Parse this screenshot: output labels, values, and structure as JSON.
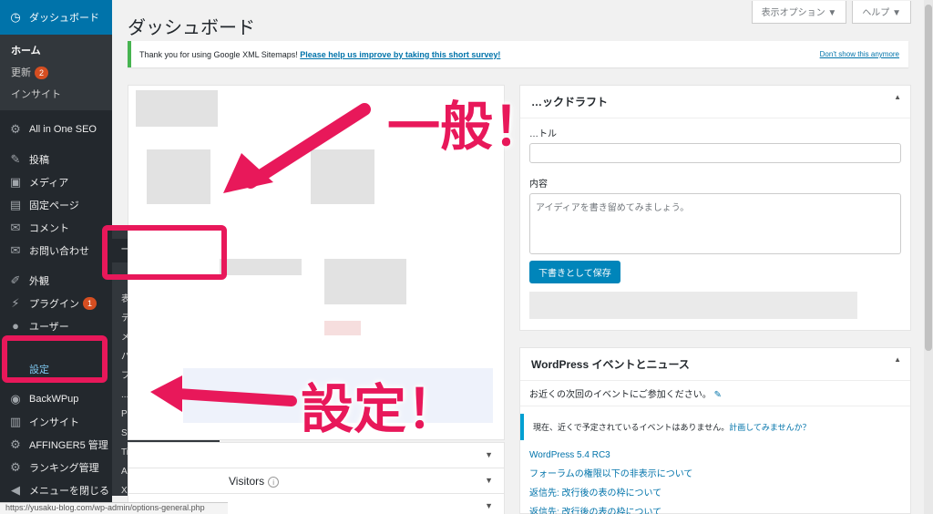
{
  "sidebar": {
    "dashboard": "ダッシュボード",
    "home": "ホーム",
    "updates": "更新",
    "updates_count": "2",
    "insights": "インサイト",
    "aioseo": "All in One SEO",
    "posts": "投稿",
    "media": "メディア",
    "pages": "固定ページ",
    "comments": "コメント",
    "contact": "お問い合わせ",
    "appearance": "外観",
    "plugins": "プラグイン",
    "plugins_count": "1",
    "users": "ユーザー",
    "settings": "設定",
    "backwpup": "BackWPup",
    "insights2": "インサイト",
    "affinger": "AFFINGER5 管理",
    "ranking": "ランキング管理",
    "collapse": "メニューを閉じる"
  },
  "flyout": {
    "items": [
      "一般",
      "表示設定",
      "ディスカッション",
      "メディア",
      "パーマリンク設定",
      "プライバシー",
      "...TeX",
      "Pz...設定",
      "Simple Mathjax",
      "TinyMCE Advanced",
      "AddQuicktag",
      "XML-Sitemap"
    ]
  },
  "status_url": "https://yusaku-blog.com/wp-admin/options-general.php",
  "header": {
    "title": "ダッシュボード",
    "screen_options": "表示オプション ▼",
    "help": "ヘルプ ▼"
  },
  "notice": {
    "text": "Thank you for using Google XML Sitemaps!",
    "link": "Please help us improve by taking this short survey!",
    "dismiss": "Don't show this anymore"
  },
  "left_rows": {
    "visitors": "Visitors",
    "visitors_prefix": "…"
  },
  "quick_draft": {
    "title": "…ックドラフト",
    "title_label": "…トル",
    "content_label": "内容",
    "content_placeholder": "アイディアを書き留めてみましょう。",
    "save_button": "下書きとして保存"
  },
  "events": {
    "title": "WordPress イベントとニュース",
    "nearby": "お近くの次回のイベントにご参加ください。",
    "none": "現在、近くで予定されているイベントはありません。",
    "plan_link": "計画してみませんか？",
    "news": [
      "WordPress 5.4 RC3",
      "フォーラムの権限以下の非表示について",
      "返信先: 改行後の表の枠について",
      "返信先: 改行後の表の枠について"
    ]
  },
  "annotations": {
    "general": "一般！",
    "settings": "設定！"
  },
  "colors": {
    "sidebar_bg": "#23282d",
    "accent": "#0073aa",
    "annotation": "#e8185a"
  }
}
